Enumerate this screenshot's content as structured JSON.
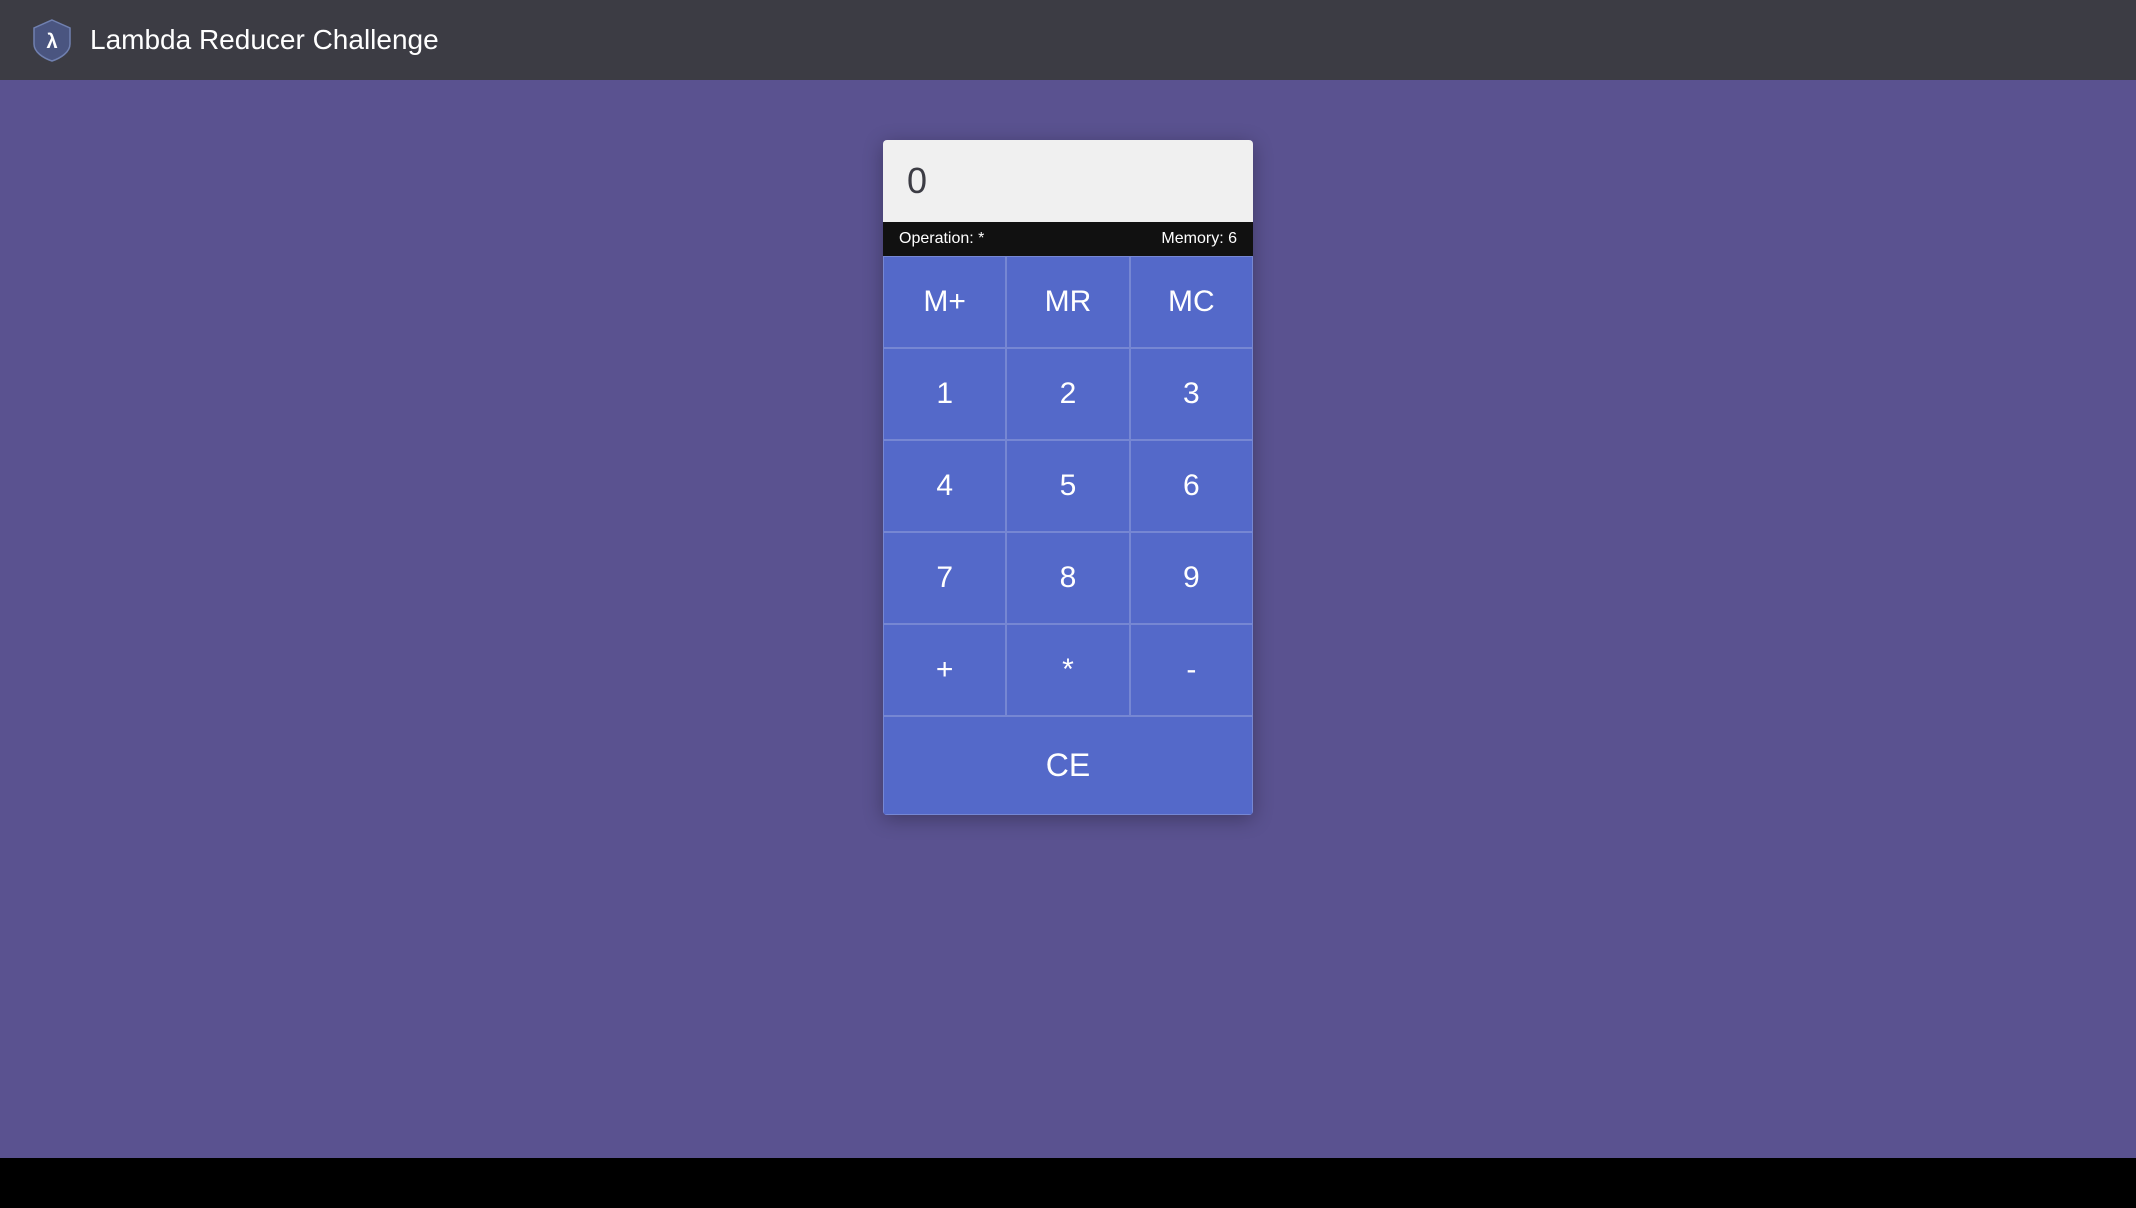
{
  "header": {
    "title": "Lambda Reducer Challenge",
    "logo_text": "λ"
  },
  "calculator": {
    "display_value": "0",
    "operation_label": "Operation:",
    "operation_value": "*",
    "memory_label": "Memory:",
    "memory_value": "6",
    "buttons": {
      "row_memory": [
        "M+",
        "MR",
        "MC"
      ],
      "row1": [
        "1",
        "2",
        "3"
      ],
      "row2": [
        "4",
        "5",
        "6"
      ],
      "row3": [
        "7",
        "8",
        "9"
      ],
      "row_ops": [
        "+",
        "*",
        "-"
      ],
      "ce": "CE"
    }
  }
}
